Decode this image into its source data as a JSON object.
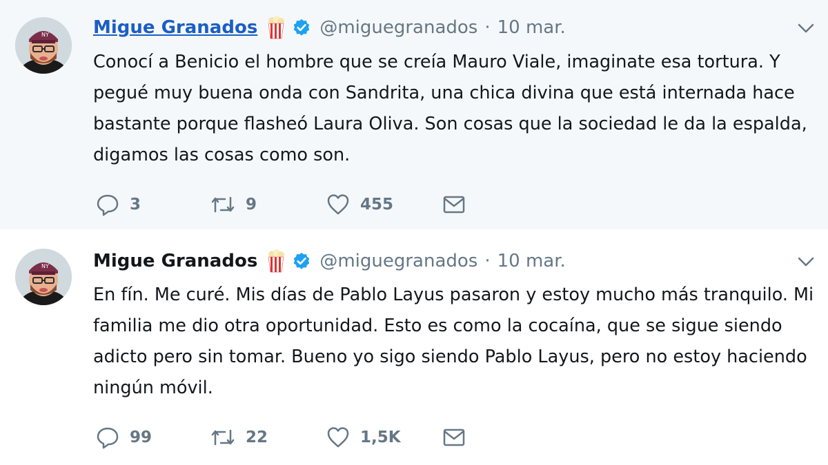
{
  "tweets": [
    {
      "name": "Migue Granados",
      "handle": "@miguegranados",
      "separator": "·",
      "date": "10 mar.",
      "text": "Conocí a Benicio el hombre que se creía Mauro Viale, imaginate esa tortura. Y pegué muy buena onda con Sandrita, una chica divina que está internada hace bastante porque flasheó Laura Oliva. Son cosas que la sociedad le da la espalda, digamos las cosas como son.",
      "replies": "3",
      "retweets": "9",
      "likes": "455"
    },
    {
      "name": "Migue Granados",
      "handle": "@miguegranados",
      "separator": "·",
      "date": "10 mar.",
      "text": "En fín. Me curé. Mis días de Pablo Layus pasaron y estoy mucho más tranquilo. Mi familia me dio otra oportunidad. Esto es como la cocaína, que se sigue siendo adicto pero sin tomar. Bueno yo sigo siendo Pablo Layus, pero no estoy haciendo ningún móvil.",
      "replies": "99",
      "retweets": "22",
      "likes": "1,5K"
    }
  ],
  "icons": {
    "verified": "verified-badge-icon",
    "emoji": "popcorn-emoji-icon",
    "menu": "chevron-down-icon",
    "reply": "reply-icon",
    "retweet": "retweet-icon",
    "like": "heart-icon",
    "message": "envelope-icon"
  },
  "colors": {
    "link_blue": "#1b5ec4",
    "verified_blue": "#1da1f2",
    "thread_line": "#c4dbf1",
    "muted_text": "#657786",
    "highlight_bg": "#f5f8fa"
  }
}
